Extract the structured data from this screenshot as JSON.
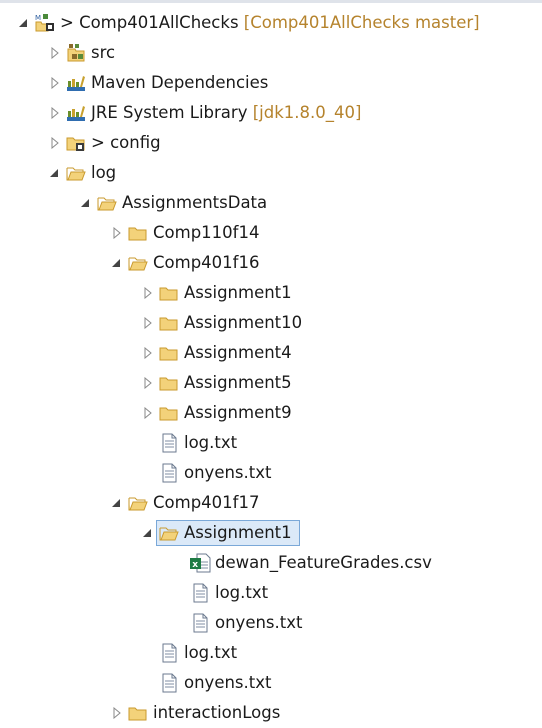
{
  "explorer": {
    "items": [
      {
        "label": "> Comp401AllChecks",
        "suffix": " [Comp401AllChecks master]",
        "icon": "maven-project-icon",
        "toggle": "expanded",
        "depth": 0
      },
      {
        "label": "src",
        "icon": "source-folder-icon",
        "toggle": "collapsed",
        "depth": 1
      },
      {
        "label": "Maven Dependencies",
        "icon": "library-icon",
        "toggle": "collapsed",
        "depth": 1
      },
      {
        "label": "JRE System Library",
        "suffix": " [jdk1.8.0_40]",
        "icon": "library-icon",
        "toggle": "collapsed",
        "depth": 1
      },
      {
        "label": "> config",
        "icon": "folder-decorated-icon",
        "toggle": "collapsed",
        "depth": 1
      },
      {
        "label": "log",
        "icon": "folder-open-icon",
        "toggle": "expanded",
        "depth": 1
      },
      {
        "label": "AssignmentsData",
        "icon": "folder-open-icon",
        "toggle": "expanded",
        "depth": 2
      },
      {
        "label": "Comp110f14",
        "icon": "folder-icon",
        "toggle": "collapsed",
        "depth": 3
      },
      {
        "label": "Comp401f16",
        "icon": "folder-open-icon",
        "toggle": "expanded",
        "depth": 3
      },
      {
        "label": "Assignment1",
        "icon": "folder-icon",
        "toggle": "collapsed",
        "depth": 4
      },
      {
        "label": "Assignment10",
        "icon": "folder-icon",
        "toggle": "collapsed",
        "depth": 4
      },
      {
        "label": "Assignment4",
        "icon": "folder-icon",
        "toggle": "collapsed",
        "depth": 4
      },
      {
        "label": "Assignment5",
        "icon": "folder-icon",
        "toggle": "collapsed",
        "depth": 4
      },
      {
        "label": "Assignment9",
        "icon": "folder-icon",
        "toggle": "collapsed",
        "depth": 4
      },
      {
        "label": "log.txt",
        "icon": "text-file-icon",
        "toggle": "none",
        "depth": 4
      },
      {
        "label": "onyens.txt",
        "icon": "text-file-icon",
        "toggle": "none",
        "depth": 4
      },
      {
        "label": "Comp401f17",
        "icon": "folder-open-icon",
        "toggle": "expanded",
        "depth": 3
      },
      {
        "label": "Assignment1",
        "icon": "folder-open-icon",
        "toggle": "expanded",
        "depth": 4,
        "selected": true
      },
      {
        "label": "dewan_FeatureGrades.csv",
        "icon": "excel-file-icon",
        "toggle": "none",
        "depth": 5
      },
      {
        "label": "log.txt",
        "icon": "text-file-icon",
        "toggle": "none",
        "depth": 5
      },
      {
        "label": "onyens.txt",
        "icon": "text-file-icon",
        "toggle": "none",
        "depth": 5
      },
      {
        "label": "log.txt",
        "icon": "text-file-icon",
        "toggle": "none",
        "depth": 4
      },
      {
        "label": "onyens.txt",
        "icon": "text-file-icon",
        "toggle": "none",
        "depth": 4
      },
      {
        "label": "interactionLogs",
        "icon": "folder-icon",
        "toggle": "collapsed",
        "depth": 3
      }
    ]
  },
  "colors": {
    "folder_fill": "#f3d27a",
    "folder_stroke": "#c99a2e",
    "suffix_text": "#b5832d",
    "selection_bg": "#dbe9f8",
    "selection_border": "#7aa8d8"
  }
}
